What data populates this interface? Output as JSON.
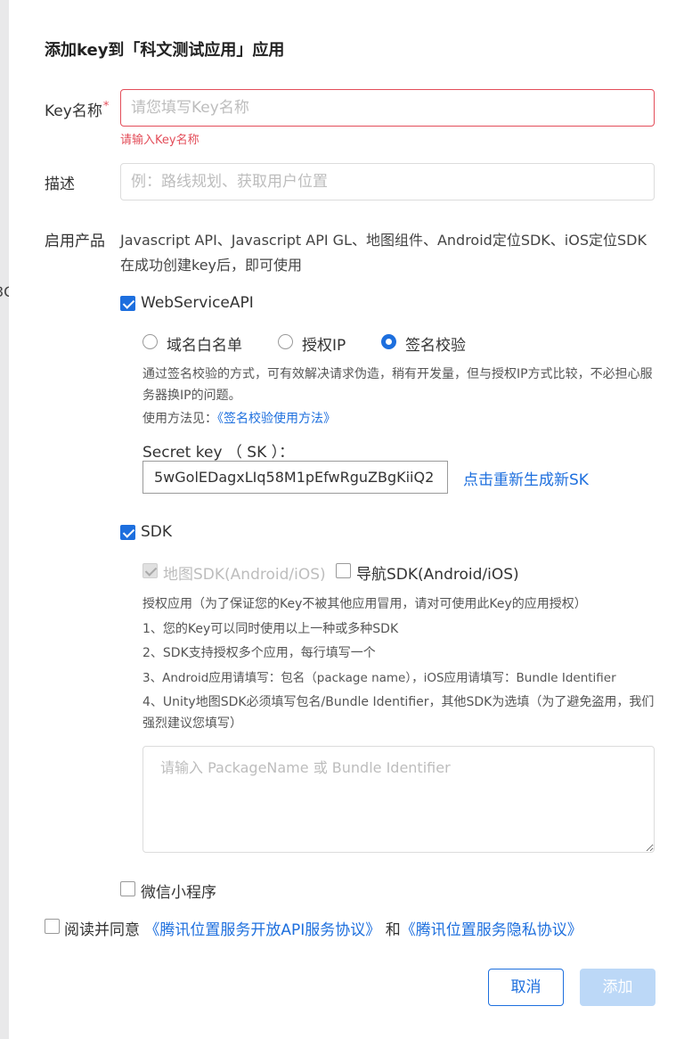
{
  "dialog": {
    "title": "添加key到「科文测试应用」应用"
  },
  "background": {
    "stray_digit": "3C"
  },
  "key_name": {
    "label": "Key名称",
    "required_mark": "*",
    "placeholder": "请您填写Key名称",
    "error": "请输入Key名称"
  },
  "description": {
    "label": "描述",
    "placeholder": "例：路线规划、获取用户位置"
  },
  "products": {
    "label": "启用产品",
    "note": "Javascript API、Javascript API GL、地图组件、Android定位SDK、iOS定位SDK在成功创建key后，即可使用",
    "webservice": {
      "label": "WebServiceAPI",
      "checked": true,
      "options": [
        "域名白名单",
        "授权IP",
        "签名校验"
      ],
      "selected": "签名校验",
      "explain": "通过签名校验的方式，可有效解决请求伪造，稍有开发量，但与授权IP方式比较，不必担心服务器换IP的问题。",
      "usage_prefix": "使用方法见：",
      "usage_link": "《签名校验使用方法》",
      "secret_label": "Secret key （ SK ）：",
      "secret_value": "5wGolEDagxLIq58M1pEfwRguZBgKiiQ2",
      "regenerate": "点击重新生成新SK"
    },
    "sdk": {
      "label": "SDK",
      "checked": true,
      "map_sdk": "地图SDK(Android/iOS)",
      "nav_sdk": "导航SDK(Android/iOS)",
      "notes": [
        "授权应用（为了保证您的Key不被其他应用冒用，请对可使用此Key的应用授权）",
        "1、您的Key可以同时使用以上一种或多种SDK",
        "2、SDK支持授权多个应用，每行填写一个",
        "3、Android应用请填写：包名（package name），iOS应用请填写：Bundle Identifier",
        "4、Unity地图SDK必须填写包名/Bundle Identifier，其他SDK为选填（为了避免盗用，我们强烈建议您填写）"
      ],
      "textarea_placeholder": "请输入 PackageName 或 Bundle Identifier"
    },
    "wechat": {
      "label": "微信小程序",
      "checked": false
    }
  },
  "agreement": {
    "prefix": "阅读并同意",
    "link1": "《腾讯位置服务开放API服务协议》",
    "joiner": " 和",
    "link2": "《腾讯位置服务隐私协议》"
  },
  "footer": {
    "cancel": "取消",
    "add": "添加"
  },
  "colors": {
    "accent": "#1d6fde",
    "error": "#e34d59",
    "disabled_button": "#bcd8f7"
  }
}
